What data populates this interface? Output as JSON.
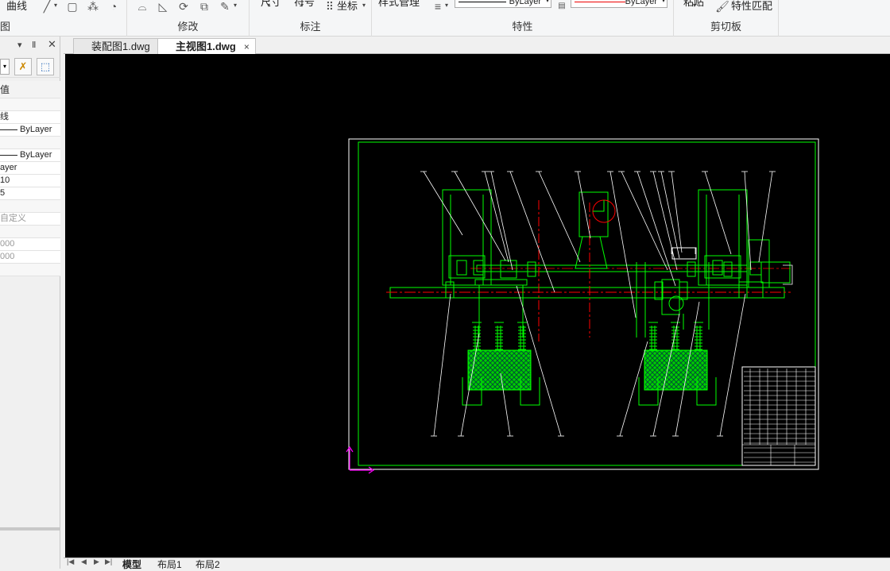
{
  "ribbon": {
    "top_items": {
      "item_left": "曲线",
      "zuobiao": "坐标",
      "style_mgr": "样式管理",
      "bylayer_line": "ByLayer",
      "bylayer_color": "ByLayer",
      "match_props": "特性匹配",
      "clip": "粘贴",
      "cut_dim_a": "尺寸",
      "cut_dim_b": "符号"
    },
    "groups": {
      "draw": "图",
      "modify": "修改",
      "annotate": "标注",
      "properties": "特性",
      "clipboard": "剪切板"
    },
    "colors": {
      "line_swatch": "#000000",
      "color_swatch": "#ff0000"
    }
  },
  "palette": {
    "header_icons": [
      "dropdown-icon",
      "pin-icon",
      "close-icon"
    ],
    "rows": [
      {
        "kind": "head",
        "text": "值"
      },
      {
        "kind": "blank",
        "text": ""
      },
      {
        "kind": "text",
        "text": "线"
      },
      {
        "kind": "swatch",
        "text": "ByLayer"
      },
      {
        "kind": "blank",
        "text": ""
      },
      {
        "kind": "swatch",
        "text": "ByLayer"
      },
      {
        "kind": "text",
        "text": "ayer"
      },
      {
        "kind": "text",
        "text": "10"
      },
      {
        "kind": "text",
        "text": "5"
      },
      {
        "kind": "blank",
        "text": ""
      },
      {
        "kind": "gray",
        "text": "自定义"
      },
      {
        "kind": "blank",
        "text": ""
      },
      {
        "kind": "gray",
        "text": "000"
      },
      {
        "kind": "gray",
        "text": "000"
      },
      {
        "kind": "blank",
        "text": ""
      }
    ]
  },
  "doc_tabs": [
    {
      "label": "装配图1.dwg",
      "active": false
    },
    {
      "label": "主视图1.dwg",
      "active": true,
      "close": "×"
    }
  ],
  "layout_tabs": [
    {
      "label": "模型",
      "active": true
    },
    {
      "label": "布局1",
      "active": false
    },
    {
      "label": "布局2",
      "active": false
    }
  ],
  "drawing": {
    "background": "#000000",
    "frame_color": "#ffffff",
    "part_color": "#00ff00",
    "center_color": "#ff0000",
    "leader_color": "#ffffff",
    "ucs_color": "#ff00ff"
  }
}
